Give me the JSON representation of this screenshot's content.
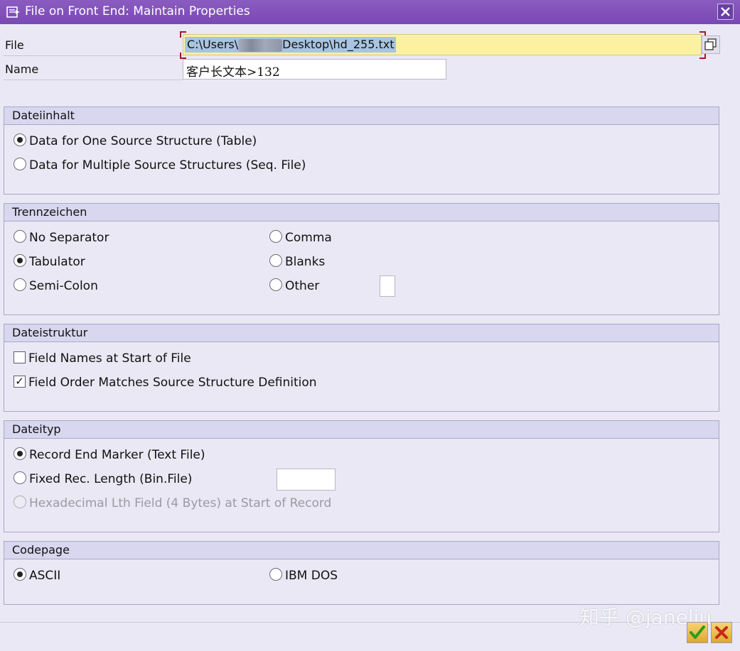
{
  "window": {
    "title": "File on Front End: Maintain Properties"
  },
  "fields": {
    "file_label": "File",
    "file_value_start": "C:\\Users\\",
    "file_value_end": "Desktop\\hd_255.txt",
    "name_label": "Name",
    "name_value": "客户长文本>132"
  },
  "dateiinhalt": {
    "title": "Dateiinhalt",
    "options": [
      {
        "label": "Data for One Source Structure (Table)",
        "selected": true
      },
      {
        "label": "Data for Multiple Source Structures (Seq. File)",
        "selected": false
      }
    ]
  },
  "trennzeichen": {
    "title": "Trennzeichen",
    "options": [
      {
        "label": "No Separator",
        "selected": false
      },
      {
        "label": "Tabulator",
        "selected": true
      },
      {
        "label": "Semi-Colon",
        "selected": false
      },
      {
        "label": "Comma",
        "selected": false
      },
      {
        "label": "Blanks",
        "selected": false
      },
      {
        "label": "Other",
        "selected": false
      }
    ],
    "other_value": ""
  },
  "dateistruktur": {
    "title": "Dateistruktur",
    "options": [
      {
        "label": "Field Names at Start of File",
        "checked": false
      },
      {
        "label": "Field Order Matches Source Structure Definition",
        "checked": true
      }
    ]
  },
  "dateityp": {
    "title": "Dateityp",
    "options": [
      {
        "label": "Record End Marker (Text File)",
        "selected": true
      },
      {
        "label": "Fixed Rec. Length (Bin.File)",
        "selected": false
      },
      {
        "label": "Hexadecimal Lth Field (4 Bytes) at Start of Record",
        "selected": false,
        "disabled": true
      }
    ],
    "fixed_length_value": ""
  },
  "codepage": {
    "title": "Codepage",
    "options": [
      {
        "label": "ASCII",
        "selected": true
      },
      {
        "label": "IBM DOS",
        "selected": false
      }
    ]
  },
  "watermark": "知乎 @janeliu",
  "colors": {
    "title_bar": "#7a48b4",
    "file_field_bg": "#fbf1a0",
    "group_header_bg": "#d8d7ef",
    "ok_icon": "#2e9a1e",
    "cancel_icon": "#c8281c"
  },
  "icons": [
    "window-icon",
    "close-icon",
    "copy-icon",
    "ok-checkmark-icon",
    "cancel-x-icon"
  ]
}
